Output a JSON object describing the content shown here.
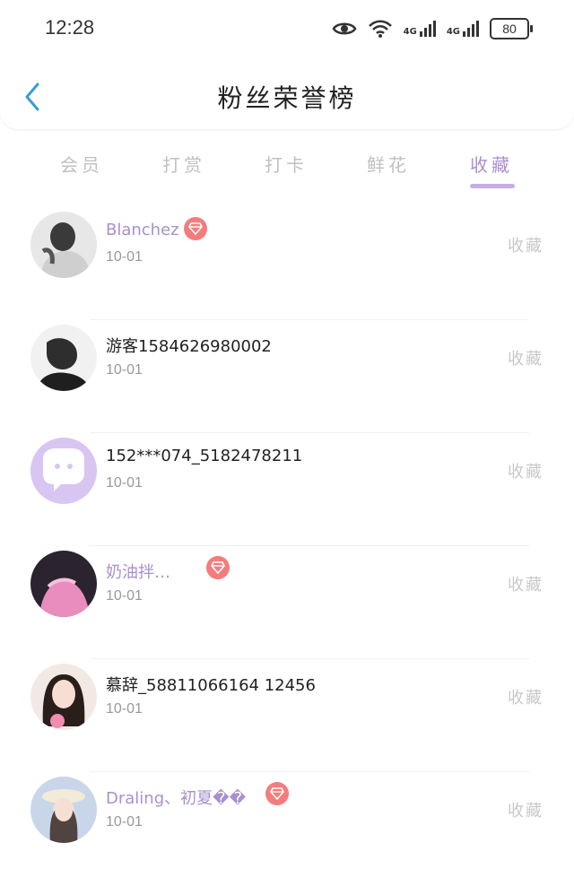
{
  "status": {
    "time": "12:28",
    "battery": "80",
    "signal1": "4G",
    "signal2": "4G"
  },
  "header": {
    "title": "粉丝荣誉榜"
  },
  "tabs": [
    {
      "label": "会员",
      "active": false
    },
    {
      "label": "打赏",
      "active": false
    },
    {
      "label": "打卡",
      "active": false
    },
    {
      "label": "鲜花",
      "active": false
    },
    {
      "label": "收藏",
      "active": true
    }
  ],
  "rows": [
    {
      "name": "Blanchez",
      "vip": true,
      "date": "10-01",
      "action": "收藏"
    },
    {
      "name": "游客1584626980002",
      "vip": false,
      "date": "10-01",
      "action": "收藏"
    },
    {
      "name": "152***074_5182478211",
      "vip": false,
      "date": "10-01",
      "action": "收藏"
    },
    {
      "name": "奶油拌…",
      "vip": true,
      "date": "10-01",
      "action": "收藏"
    },
    {
      "name": "慕辞_58811066164 12456",
      "vip": false,
      "date": "10-01",
      "action": "收藏"
    },
    {
      "name": "Draling、初夏��",
      "vip": true,
      "date": "10-01",
      "action": "收藏"
    }
  ],
  "icons": {
    "status": [
      "eye-icon",
      "wifi-icon",
      "signal-icon",
      "signal-icon",
      "battery-icon"
    ],
    "back": "chevron-left-icon",
    "badge": "diamond-badge-icon"
  },
  "colors": {
    "accent": "#a98fd0",
    "badge": "#f47c7c",
    "muted": "#c0c0c0"
  }
}
